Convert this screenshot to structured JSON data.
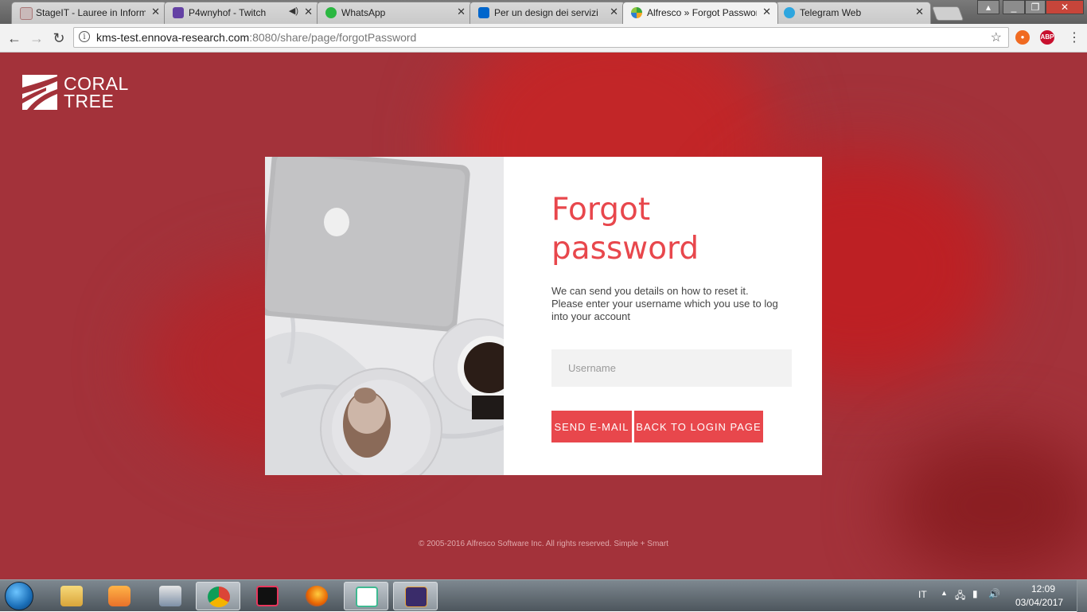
{
  "browser": {
    "tabs": [
      {
        "title": "StageIT - Lauree in Informatica",
        "favicon": "stageit-icon"
      },
      {
        "title": "P4wnyhof - Twitch",
        "favicon": "twitch-icon",
        "audio": "speaker-icon"
      },
      {
        "title": "WhatsApp",
        "favicon": "whatsapp-icon"
      },
      {
        "title": "Per un design dei servizi",
        "favicon": "italia-icon"
      },
      {
        "title": "Alfresco » Forgot Password",
        "favicon": "alfresco-icon",
        "active": true
      },
      {
        "title": "Telegram Web",
        "favicon": "telegram-icon"
      }
    ],
    "url_host": "kms-test.ennova-research.com",
    "url_path": ":8080/share/page/forgotPassword"
  },
  "page": {
    "logo_line1": "CORAL",
    "logo_line2": "TREE",
    "title_line1": "Forgot",
    "title_line2": "password",
    "description_line1": "We can send you details on how to reset it.",
    "description_line2": "Please enter your username which you use to log",
    "description_line3": "into your account",
    "username_placeholder": "Username",
    "send_button": "SEND E-MAIL",
    "back_button": "BACK TO LOGIN PAGE",
    "footer": "© 2005-2016 Alfresco Software Inc. All rights reserved. Simple + Smart"
  },
  "taskbar": {
    "apps": [
      "file-explorer-icon",
      "media-player-icon",
      "network-tool-icon",
      "chrome-icon",
      "intellij-icon",
      "firefox-icon",
      "slack-icon",
      "java-ee-ide-icon"
    ],
    "language": "IT",
    "time": "12:09",
    "date": "03/04/2017"
  },
  "colors": {
    "accent": "#e8474c",
    "background": "#a3323a"
  }
}
